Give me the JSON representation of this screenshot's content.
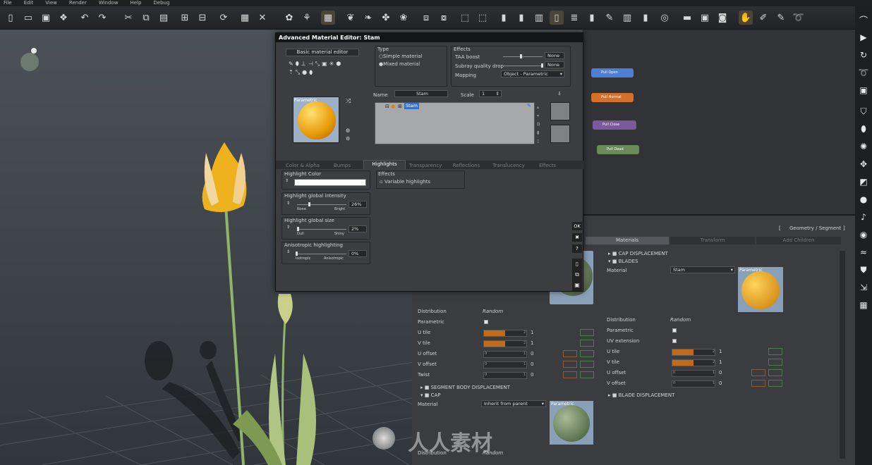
{
  "menu": [
    "File",
    "Edit",
    "View",
    "Render",
    "Window",
    "Help",
    "Debug"
  ],
  "editor": {
    "title": "Advanced Material Editor: Stam",
    "basic_btn": "Basic material editor",
    "type_label": "Type",
    "type_simple": "Simple material",
    "type_mixed": "Mixed material",
    "effects_label": "Effects",
    "taa_label": "TAA boost",
    "taa_val": "None",
    "subray_label": "Subray quality drop",
    "subray_val": "None",
    "mapping_label": "Mapping",
    "mapping_val": "Object - Parametric",
    "name_label": "Name",
    "name_val": "Stam",
    "scale_label": "Scale",
    "scale_val": "1",
    "tree_item": "Stam",
    "preview_label": "Parametric",
    "tabs": [
      "Color & Alpha",
      "Bumps",
      "Highlights",
      "Transparency",
      "Reflections",
      "Translucency",
      "Effects"
    ],
    "hl_color_label": "Highlight Color",
    "hl_intensity_label": "Highlight global intensity",
    "hl_intensity_min": "None",
    "hl_intensity_max": "Bright",
    "hl_intensity_val": "26%",
    "hl_size_label": "Highlight global size",
    "hl_size_min": "Dull",
    "hl_size_max": "Shiny",
    "hl_size_val": "2%",
    "aniso_label": "Anisotropic highlighting",
    "aniso_min": "Isotropic",
    "aniso_max": "Anisotropic",
    "aniso_val": "0%",
    "effects_group": "Effects",
    "variable_hl": "Variable highlights",
    "ok": "OK",
    "close": "✖",
    "help": "?"
  },
  "nodes": [
    {
      "label": "Pull Open",
      "color": "#4f7fd4"
    },
    {
      "label": "Pull Normal",
      "color": "#d4702a"
    },
    {
      "label": "Pull Close",
      "color": "#7a5a9a"
    },
    {
      "label": "Pull Dead",
      "color": "#6a8a5a"
    }
  ],
  "panel": {
    "breadcrumb": "Geometry / Segment",
    "bracket_l": "[",
    "bracket_r": "]",
    "tabs": [
      "Materials",
      "Transform",
      "Add Children"
    ],
    "left": {
      "distribution_label": "Distribution",
      "distribution_val": "Random",
      "parametric_label": "Parametric",
      "u_tile_label": "U tile",
      "u_tile_val": "1",
      "u_tile_max": "2",
      "v_tile_label": "V tile",
      "v_tile_val": "1",
      "v_tile_max": "2",
      "u_offset_label": "U offset",
      "u_offset_val": "0",
      "u_offset_max": "1",
      "u_offset_min": "0",
      "v_offset_label": "V offset",
      "v_offset_val": "0",
      "v_offset_max": "1",
      "v_offset_min": "0",
      "twist_label": "Twist",
      "twist_val": "0",
      "twist_max": "1",
      "twist_min": "0",
      "segment_body": "SEGMENT BODY DISPLACEMENT",
      "cap": "CAP",
      "material_label": "Material",
      "material_val": "Inherit from parent",
      "preview_label": "Parametric",
      "distribution2_label": "Distribution",
      "distribution2_val": "Random"
    },
    "right": {
      "cap_disp": "CAP DISPLACEMENT",
      "blades": "BLADES",
      "material_label": "Material",
      "material_val": "Stam",
      "preview_label": "Parametric",
      "distribution_label": "Distribution",
      "distribution_val": "Random",
      "parametric_label": "Parametric",
      "uv_ext_label": "UV extension",
      "u_tile_label": "U tile",
      "u_tile_val": "1",
      "u_tile_max": "2",
      "v_tile_label": "V tile",
      "v_tile_val": "1",
      "v_tile_max": "2",
      "u_offset_label": "U offset",
      "u_offset_val": "0",
      "u_offset_max": "1",
      "u_offset_min": "0",
      "v_offset_label": "V offset",
      "v_offset_val": "0",
      "v_offset_max": "1",
      "v_offset_min": "0",
      "blade_disp": "BLADE DISPLACEMENT"
    }
  },
  "watermark": "人人素材",
  "colors": {
    "accent": "#c06a1a",
    "editor_bg": "#3b3d41"
  }
}
